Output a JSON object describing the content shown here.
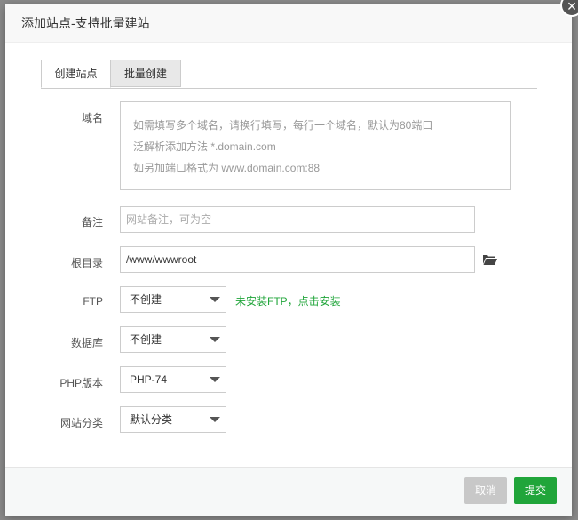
{
  "modal": {
    "title": "添加站点-支持批量建站",
    "close_glyph": "×"
  },
  "tabs": [
    {
      "label": "创建站点",
      "active": true
    },
    {
      "label": "批量创建",
      "active": false
    }
  ],
  "form": {
    "domain": {
      "label": "域名",
      "placeholder_lines": [
        "如需填写多个域名，请换行填写，每行一个域名，默认为80端口",
        "泛解析添加方法 *.domain.com",
        "如另加端口格式为 www.domain.com:88"
      ]
    },
    "remark": {
      "label": "备注",
      "placeholder": "网站备注，可为空"
    },
    "root_dir": {
      "label": "根目录",
      "value": "/www/wwwroot",
      "icon": "folder-open-icon"
    },
    "ftp": {
      "label": "FTP",
      "selected": "不创建",
      "hint": "未安装FTP，点击安装"
    },
    "database": {
      "label": "数据库",
      "selected": "不创建"
    },
    "php_version": {
      "label": "PHP版本",
      "selected": "PHP-74"
    },
    "category": {
      "label": "网站分类",
      "selected": "默认分类"
    }
  },
  "footer": {
    "cancel_label": "取消",
    "submit_label": "提交"
  },
  "colors": {
    "accent_green": "#20a53a",
    "cancel_gray": "#c8c8c8"
  }
}
